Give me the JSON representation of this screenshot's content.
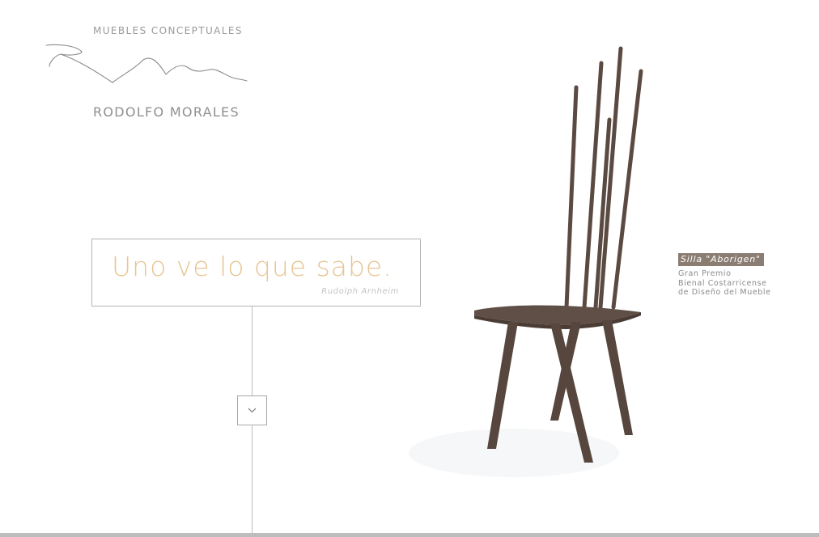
{
  "brand": {
    "tagline": "MUEBLES CONCEPTUALES",
    "name": "RODOLFO MORALES"
  },
  "quote": {
    "text": "Uno ve lo que sabe.",
    "author": "Rudolph Arnheim"
  },
  "scroll": {
    "icon": "chevron-down-icon"
  },
  "product": {
    "title": "Silla \"Aborigen\"",
    "award": [
      "Gran Premio",
      "Bienal Costarricense",
      "de Diseño del Mueble"
    ]
  },
  "colors": {
    "quote_accent": "#e7c593",
    "caption_bg": "#8b7d72",
    "chair_wood": "#5a4a42"
  }
}
